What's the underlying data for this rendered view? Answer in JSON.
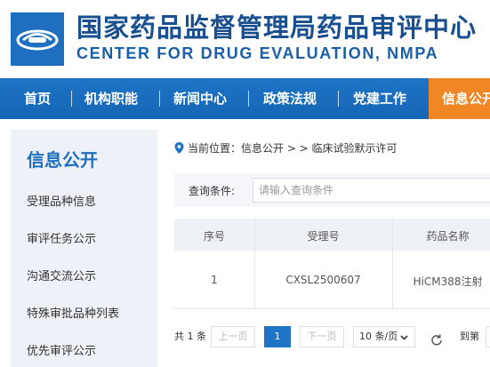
{
  "header": {
    "title_cn": "国家药品监督管理局药品审评中心",
    "title_en": "CENTER FOR DRUG EVALUATION, NMPA"
  },
  "nav": {
    "items": [
      "首页",
      "机构职能",
      "新闻中心",
      "政策法规",
      "党建工作",
      "信息公开"
    ],
    "active_color": "#f18724",
    "bar_color": "#1f74c6"
  },
  "sidebar": {
    "title": "信息公开",
    "items": [
      "受理品种信息",
      "审评任务公示",
      "沟通交流公示",
      "特殊审批品种列表",
      "优先审评公示"
    ]
  },
  "breadcrumb": {
    "icon": "location-pin-icon",
    "text": "当前位置：信息公开 > > 临床试验默示许可"
  },
  "query": {
    "label": "查询条件:",
    "placeholder": "请输入查询条件"
  },
  "table": {
    "columns": [
      "序号",
      "受理号",
      "药品名称"
    ],
    "rows": [
      [
        "1",
        "CXSL2500607",
        "HiCM388注射"
      ]
    ]
  },
  "pagination": {
    "total": "共 1 条",
    "prev": "上一页",
    "current": "1",
    "next": "下一页",
    "page_size": "10 条/页",
    "refresh_icon": "refresh-icon",
    "goto": "到第"
  }
}
